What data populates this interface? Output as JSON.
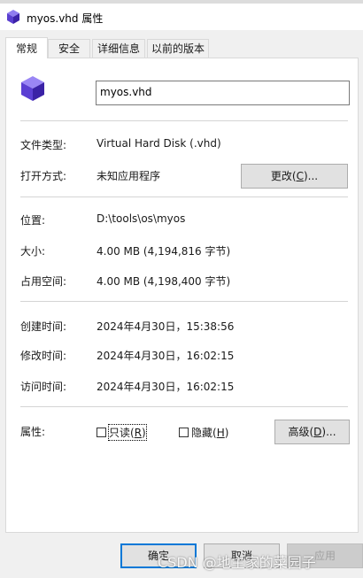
{
  "window": {
    "title": "myos.vhd 属性"
  },
  "tabs": [
    {
      "label": "常规",
      "active": true
    },
    {
      "label": "安全",
      "active": false
    },
    {
      "label": "详细信息",
      "active": false
    },
    {
      "label": "以前的版本",
      "active": false
    }
  ],
  "general": {
    "file_name": "myos.vhd",
    "type_label": "文件类型:",
    "type_value": "Virtual Hard Disk (.vhd)",
    "opens_with_label": "打开方式:",
    "opens_with_value": "未知应用程序",
    "change_button": {
      "text": "更改(",
      "key": "C",
      "tail": ")..."
    },
    "location_label": "位置:",
    "location_value": "D:\\tools\\os\\myos",
    "size_label": "大小:",
    "size_value": "4.00 MB (4,194,816 字节)",
    "size_on_disk_label": "占用空间:",
    "size_on_disk_value": "4.00 MB (4,198,400 字节)",
    "created_label": "创建时间:",
    "created_value": "2024年4月30日，15:38:56",
    "modified_label": "修改时间:",
    "modified_value": "2024年4月30日，16:02:15",
    "accessed_label": "访问时间:",
    "accessed_value": "2024年4月30日，16:02:15",
    "attributes_label": "属性:",
    "readonly": {
      "text": "只读(",
      "key": "R",
      "tail": ")",
      "checked": false
    },
    "hidden": {
      "text": "隐藏(",
      "key": "H",
      "tail": ")",
      "checked": false
    },
    "advanced_button": {
      "text": "高级(",
      "key": "D",
      "tail": ")..."
    }
  },
  "footer": {
    "ok_label": "确定",
    "cancel_label": "取消",
    "apply_label": "应用"
  },
  "watermark": "CSDN @地主家的菜园子",
  "colors": {
    "accent": "#0078d7",
    "panel_bg": "#ffffff",
    "dialog_bg": "#f0f0f0"
  }
}
